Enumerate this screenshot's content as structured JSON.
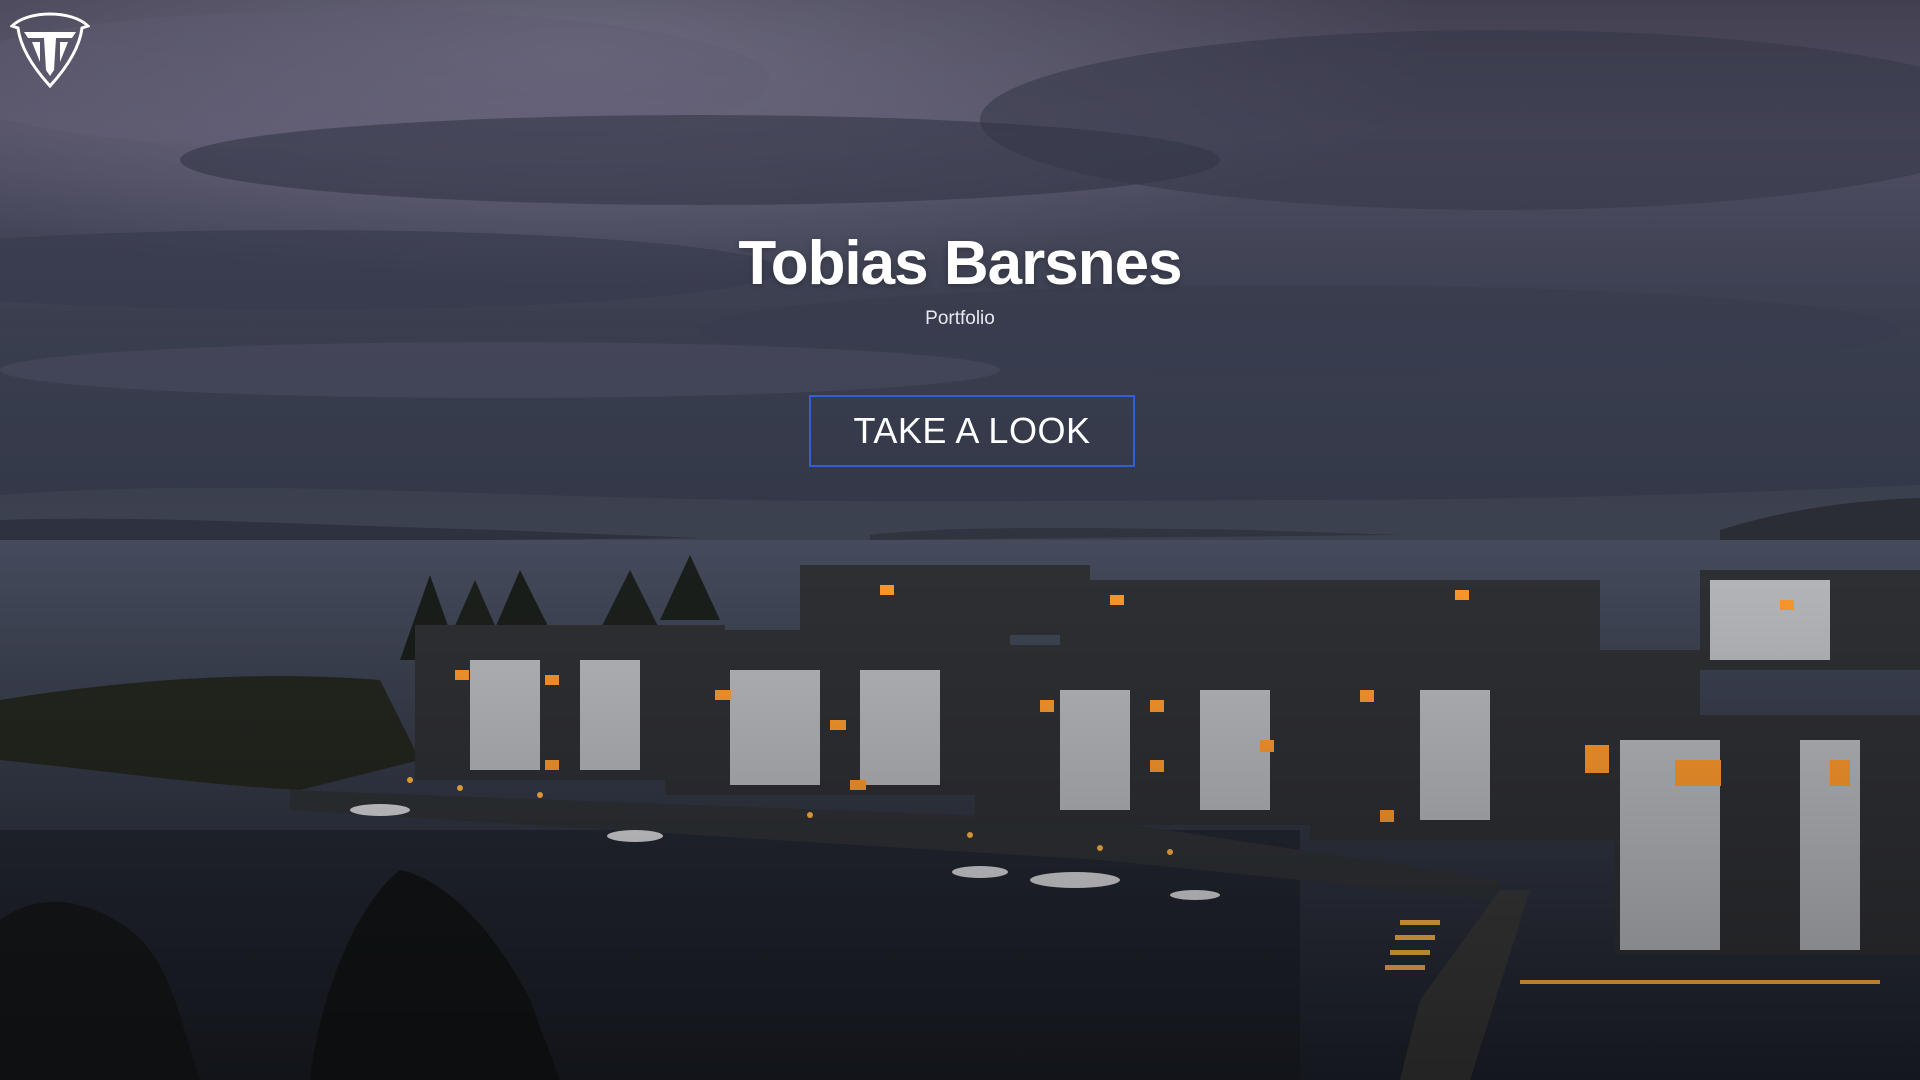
{
  "site": {
    "logo_icon": "tb-shield-logo-icon"
  },
  "hero": {
    "title": "Tobias Barsnes",
    "subtitle": "Portfolio",
    "cta_label": "TAKE A LOOK",
    "background_description_icon": "dusk-waterfront-photo"
  },
  "colors": {
    "cta_border": "#2f5fd9",
    "text": "#ffffff",
    "window_glow": "#ff9a2e"
  }
}
